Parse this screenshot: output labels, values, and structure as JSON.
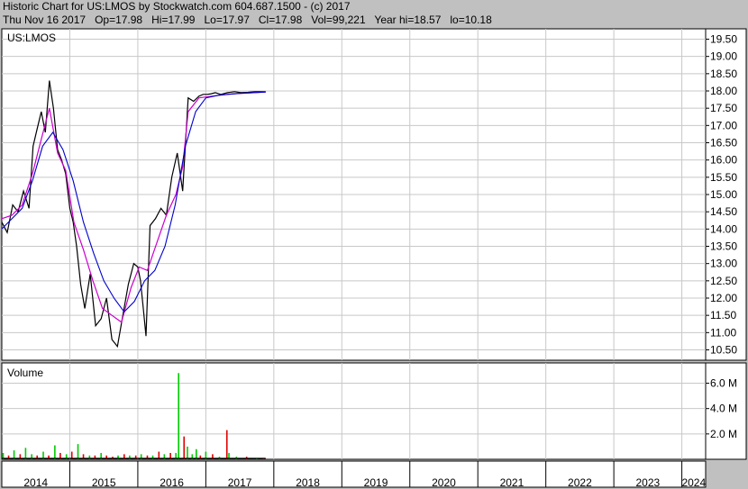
{
  "header": {
    "line1": "Historic Chart for US:LMOS by Stockwatch.com 604.687.1500 - (c) 2017",
    "line2": "Thu Nov 16 2017   Op=17.98   Hi=17.99   Lo=17.97   Cl=17.98   Vol=99,221   Year hi=18.57   lo=10.18"
  },
  "colors": {
    "price": "#000000",
    "ma_short": "#cc00cc",
    "ma_long": "#0000cc",
    "vol_up": "#00cc00",
    "vol_down": "#e00000",
    "vol_flat": "#000000"
  },
  "chart_data": [
    {
      "type": "line",
      "title": "US:LMOS",
      "ylim": [
        10.2,
        19.8
      ],
      "y_ticks": [
        "10.50",
        "11.00",
        "11.50",
        "12.00",
        "12.50",
        "13.00",
        "13.50",
        "14.00",
        "14.50",
        "15.00",
        "15.50",
        "16.00",
        "16.50",
        "17.00",
        "17.50",
        "18.00",
        "18.50",
        "19.00",
        "19.50"
      ],
      "x_ticks": [
        "2014",
        "2015",
        "2016",
        "2017",
        "2018",
        "2019",
        "2020",
        "2021",
        "2022",
        "2023",
        "2024"
      ],
      "xlim": [
        2014.0,
        2024.35
      ],
      "grid": true,
      "series": [
        {
          "kind": "price",
          "x": [
            2014.0,
            2014.08,
            2014.16,
            2014.24,
            2014.32,
            2014.4,
            2014.46,
            2014.52,
            2014.58,
            2014.64,
            2014.7,
            2014.76,
            2014.82,
            2014.88,
            2014.94,
            2015.0,
            2015.05,
            2015.1,
            2015.16,
            2015.22,
            2015.3,
            2015.38,
            2015.46,
            2015.54,
            2015.62,
            2015.7,
            2015.78,
            2015.86,
            2015.94,
            2016.0,
            2016.04,
            2016.08,
            2016.12,
            2016.18,
            2016.26,
            2016.34,
            2016.42,
            2016.5,
            2016.58,
            2016.66,
            2016.74,
            2016.82,
            2016.9,
            2016.96,
            2017.02,
            2017.08,
            2017.14,
            2017.22,
            2017.32,
            2017.42,
            2017.52,
            2017.62,
            2017.72,
            2017.82,
            2017.88
          ],
          "y": [
            14.2,
            13.9,
            14.7,
            14.5,
            15.1,
            14.6,
            16.4,
            16.9,
            17.4,
            16.8,
            18.3,
            17.5,
            16.3,
            16.0,
            15.6,
            14.6,
            14.2,
            13.5,
            12.4,
            11.7,
            12.7,
            11.2,
            11.4,
            12.0,
            10.8,
            10.6,
            11.5,
            12.4,
            13.0,
            12.9,
            12.5,
            11.7,
            10.9,
            14.1,
            14.3,
            14.6,
            14.4,
            15.5,
            16.2,
            15.1,
            17.8,
            17.7,
            17.85,
            17.9,
            17.9,
            17.92,
            17.95,
            17.9,
            17.95,
            17.98,
            17.95,
            17.96,
            17.98,
            17.98,
            17.98
          ]
        },
        {
          "kind": "ma_short",
          "x": [
            2014.0,
            2014.15,
            2014.3,
            2014.45,
            2014.58,
            2014.7,
            2014.82,
            2014.94,
            2015.06,
            2015.2,
            2015.34,
            2015.48,
            2015.62,
            2015.76,
            2015.9,
            2016.02,
            2016.14,
            2016.28,
            2016.42,
            2016.56,
            2016.66,
            2016.74,
            2016.9,
            2017.1,
            2017.4,
            2017.88
          ],
          "y": [
            14.3,
            14.4,
            14.7,
            15.6,
            16.6,
            17.5,
            16.2,
            15.7,
            14.2,
            13.4,
            12.5,
            11.7,
            11.5,
            11.3,
            12.3,
            12.9,
            12.8,
            13.6,
            14.4,
            15.0,
            15.8,
            17.4,
            17.8,
            17.85,
            17.92,
            17.97
          ]
        },
        {
          "kind": "ma_long",
          "x": [
            2014.0,
            2014.15,
            2014.3,
            2014.45,
            2014.6,
            2014.75,
            2014.9,
            2015.05,
            2015.2,
            2015.35,
            2015.5,
            2015.65,
            2015.8,
            2015.95,
            2016.1,
            2016.25,
            2016.4,
            2016.55,
            2016.7,
            2016.85,
            2017.0,
            2017.2,
            2017.5,
            2017.88
          ],
          "y": [
            14.0,
            14.3,
            14.6,
            15.4,
            16.4,
            16.8,
            16.3,
            15.4,
            14.2,
            13.3,
            12.5,
            12.0,
            11.6,
            11.9,
            12.5,
            12.8,
            13.5,
            14.7,
            16.4,
            17.4,
            17.8,
            17.88,
            17.93,
            17.97
          ]
        }
      ]
    },
    {
      "type": "bar",
      "title": "Volume",
      "ylim": [
        0,
        7.6
      ],
      "y_ticks": [
        "2.0 M",
        "4.0 M",
        "6.0 M"
      ],
      "grid": true,
      "series": [
        {
          "name": "",
          "x": [
            2014.02,
            2014.1,
            2014.18,
            2014.27,
            2014.35,
            2014.44,
            2014.52,
            2014.61,
            2014.69,
            2014.78,
            2014.86,
            2014.95,
            2015.03,
            2015.12,
            2015.2,
            2015.29,
            2015.37,
            2015.46,
            2015.54,
            2015.63,
            2015.71,
            2015.8,
            2015.88,
            2015.97,
            2016.05,
            2016.14,
            2016.22,
            2016.31,
            2016.39,
            2016.48,
            2016.56,
            2016.6,
            2016.68,
            2016.73,
            2016.8,
            2016.86,
            2016.92,
            2017.0,
            2017.1,
            2017.2,
            2017.31,
            2017.34,
            2017.45,
            2017.6,
            2017.75,
            2017.85
          ],
          "values": [
            0.5,
            0.3,
            0.7,
            0.4,
            0.9,
            0.4,
            0.3,
            0.6,
            0.3,
            1.1,
            0.5,
            0.4,
            0.6,
            1.2,
            0.4,
            0.3,
            0.3,
            0.5,
            0.3,
            0.2,
            0.3,
            0.4,
            0.3,
            0.3,
            0.4,
            0.3,
            0.3,
            0.6,
            0.4,
            0.5,
            0.5,
            6.8,
            1.8,
            1.0,
            0.4,
            0.8,
            0.3,
            0.6,
            0.4,
            0.2,
            2.3,
            0.5,
            0.2,
            0.2,
            0.1,
            0.1
          ],
          "dir": [
            "u",
            "d",
            "u",
            "d",
            "u",
            "u",
            "d",
            "u",
            "d",
            "u",
            "d",
            "u",
            "d",
            "u",
            "d",
            "u",
            "d",
            "u",
            "d",
            "d",
            "u",
            "d",
            "u",
            "d",
            "u",
            "d",
            "u",
            "d",
            "u",
            "d",
            "u",
            "u",
            "d",
            "u",
            "u",
            "u",
            "d",
            "u",
            "d",
            "u",
            "d",
            "u",
            "u",
            "d",
            "u",
            "d"
          ]
        }
      ]
    }
  ]
}
